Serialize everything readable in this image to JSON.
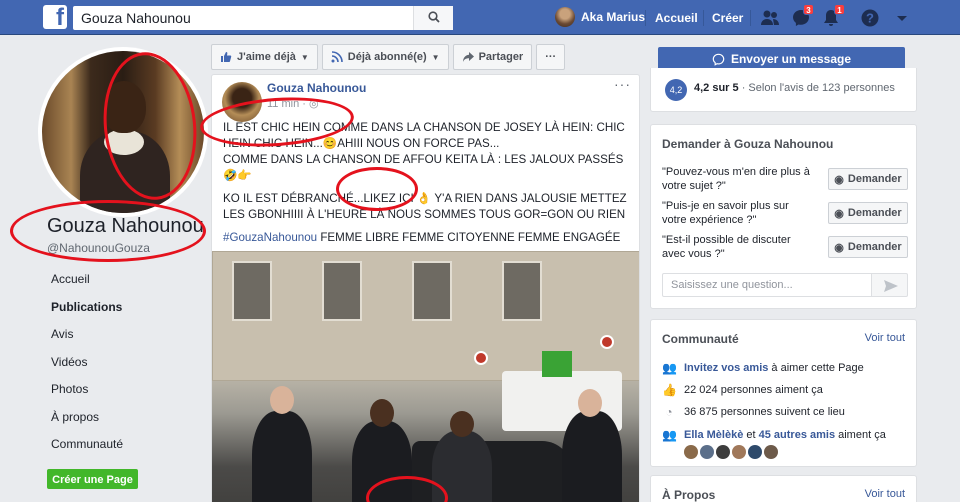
{
  "topbar": {
    "search_value": "Gouza Nahounou",
    "user_name": "Aka Marius",
    "home_label": "Accueil",
    "create_label": "Créer",
    "messages_badge": "3",
    "notifications_badge": "1"
  },
  "page": {
    "name": "Gouza Nahounou",
    "handle": "@NahounouGouza"
  },
  "left_nav": [
    "Accueil",
    "Publications",
    "Avis",
    "Vidéos",
    "Photos",
    "À propos",
    "Communauté"
  ],
  "left_nav_active": "Publications",
  "create_page_label": "Créer une Page",
  "actions": {
    "like_label": "J'aime déjà",
    "follow_label": "Déjà abonné(e)",
    "share_label": "Partager",
    "more_label": "···"
  },
  "post": {
    "author": "Gouza Nahounou",
    "time": "11 min",
    "paragraph1": "IL EST CHIC HEIN COMME DANS LA CHANSON DE JOSEY LÀ HEIN: CHIC HEIN CHIC HEIN...😊AHIII NOUS ON FORCE PAS...",
    "paragraph1b": "COMME DANS LA CHANSON DE AFFOU KEITA LÀ : LES JALOUX PASSÉS 🤣👉",
    "paragraph2": "KO IL EST DÉBRANCHÉ...LIKEZ ICI 👌 Y'A RIEN DANS JALOUSIE METTEZ LES GBONHIIII À L'HEURE LÀ NOUS SOMMES TOUS GOR=GON OU RIEN",
    "hashtag": "#GouzaNahounou",
    "tagline": " FEMME LIBRE FEMME CITOYENNE FEMME ENGAGÉE"
  },
  "message_button": "Envoyer un message",
  "rating": {
    "score": "4,2",
    "score_text": "4,2 sur 5",
    "detail": " · Selon l'avis de 123 personnes"
  },
  "ask": {
    "title": "Demander à Gouza Nahounou",
    "questions": [
      "\"Pouvez-vous m'en dire plus à votre sujet ?\"",
      "\"Puis-je en savoir plus sur votre expérience ?\"",
      "\"Est-il possible de discuter avec vous ?\""
    ],
    "button_label": "Demander",
    "placeholder": "Saisissez une question..."
  },
  "community": {
    "title": "Communauté",
    "see_all": "Voir tout",
    "invite_link": "Invitez vos amis",
    "invite_rest": " à aimer cette Page",
    "likes": "22 024 personnes aiment ça",
    "follows": "36 875 personnes suivent ce lieu",
    "friend_name": "Ella Mèlèkè",
    "friend_mid": " et ",
    "friend_others": "45 autres amis",
    "friend_rest": " aiment ça"
  },
  "about": {
    "title": "À Propos",
    "see_all": "Voir tout"
  },
  "colors": {
    "brand": "#4267b2",
    "annotation": "#e4121d",
    "create_page": "#42b72a"
  }
}
